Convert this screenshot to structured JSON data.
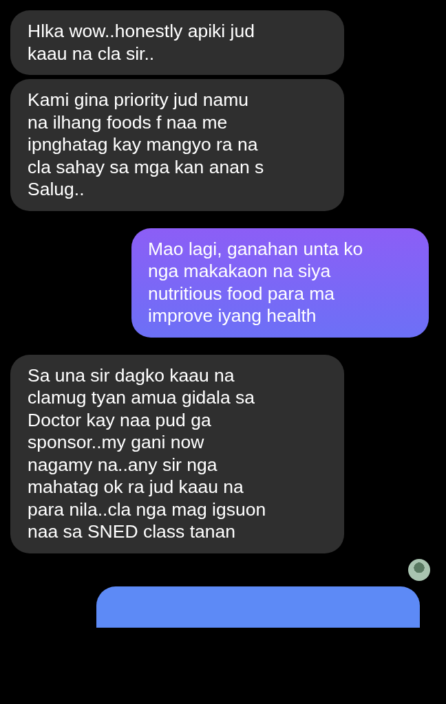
{
  "messages": [
    {
      "kind": "received",
      "text": "Hlka wow..honestly apiki jud\nkaau na cla sir.."
    },
    {
      "kind": "received",
      "text": "Kami gina priority jud namu\nna ilhang foods f naa me\nipnghatag kay mangyo ra na\ncla sahay sa mga kan anan s\nSalug.."
    },
    {
      "kind": "sent",
      "text": "Mao lagi, ganahan unta ko\nnga makakaon na siya\nnutritious food para ma\nimprove iyang health"
    },
    {
      "kind": "received",
      "text": "Sa una sir dagko kaau na\nclamug tyan amua gidala sa\nDoctor kay naa pud ga\nsponsor..my gani now\nnagamy na..any sir nga\nmahatag ok ra jud kaau na\npara nila..cla nga mag igsuon\nnaa sa SNED class tanan"
    },
    {
      "kind": "seen"
    },
    {
      "kind": "sent_partial"
    }
  ]
}
